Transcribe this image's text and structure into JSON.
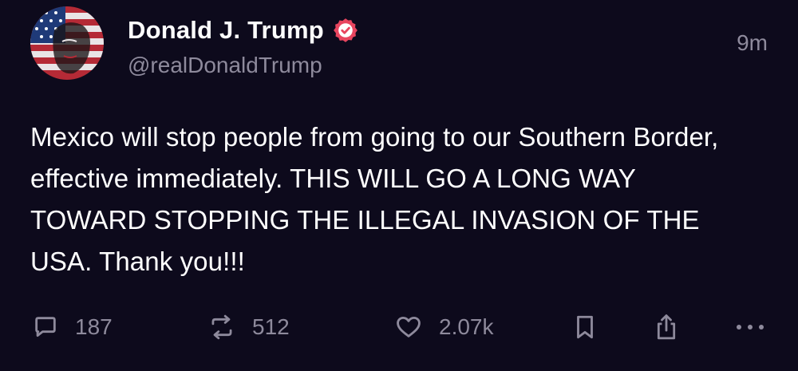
{
  "post": {
    "author": {
      "display_name": "Donald J. Trump",
      "handle": "@realDonaldTrump",
      "verified": true,
      "avatar_icon": "flag-portrait-avatar"
    },
    "timestamp": "9m",
    "text": "Mexico will stop people from going to our Southern Border, effective immediately. THIS WILL GO A LONG WAY TOWARD STOPPING THE ILLEGAL INVASION OF THE USA. Thank you!!!",
    "actions": {
      "reply": {
        "icon": "reply-bubble-icon",
        "count": "187"
      },
      "repost": {
        "icon": "repost-icon",
        "count": "512"
      },
      "like": {
        "icon": "heart-icon",
        "count": "2.07k"
      },
      "bookmark": {
        "icon": "bookmark-icon"
      },
      "share": {
        "icon": "share-icon"
      },
      "more": {
        "icon": "more-dots-icon"
      }
    }
  },
  "colors": {
    "background": "#0d0a1c",
    "primary_text": "#ffffff",
    "secondary_text": "#8e8a9c",
    "verified_badge": "#e8455f"
  }
}
